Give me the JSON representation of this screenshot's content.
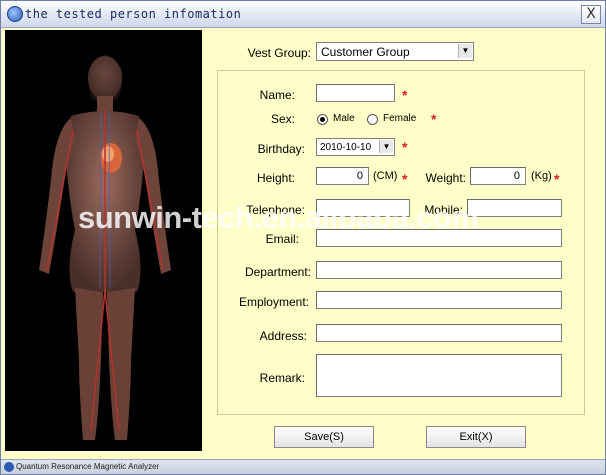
{
  "window": {
    "title": "the tested person infomation",
    "close_label": "X"
  },
  "form": {
    "vest_group": {
      "label": "Vest Group:",
      "value": "Customer Group"
    },
    "name": {
      "label": "Name:",
      "value": ""
    },
    "sex": {
      "label": "Sex:",
      "male": "Male",
      "female": "Female",
      "selected": "Male"
    },
    "birthday": {
      "label": "Birthday:",
      "value": "2010-10-10"
    },
    "height": {
      "label": "Height:",
      "value": "0",
      "unit": "(CM)"
    },
    "weight": {
      "label": "Weight:",
      "value": "0",
      "unit": "(Kg)"
    },
    "telephone": {
      "label": "Telephone:",
      "value": ""
    },
    "mobile": {
      "label": "Mobile:",
      "value": ""
    },
    "email": {
      "label": "Email:",
      "value": ""
    },
    "department": {
      "label": "Department:",
      "value": ""
    },
    "employment": {
      "label": "Employment:",
      "value": ""
    },
    "address": {
      "label": "Address:",
      "value": ""
    },
    "remark": {
      "label": "Remark:",
      "value": ""
    },
    "required_mark": "*"
  },
  "buttons": {
    "save": "Save(S)",
    "exit": "Exit(X)"
  },
  "watermark": "sunwin-tech.en.alibaba.com",
  "statusbar": {
    "text": "Quantum Resonance Magnetic Analyzer"
  },
  "colors": {
    "background": "#ffffc9",
    "required": "#d32020",
    "photo_bg": "#000000"
  }
}
